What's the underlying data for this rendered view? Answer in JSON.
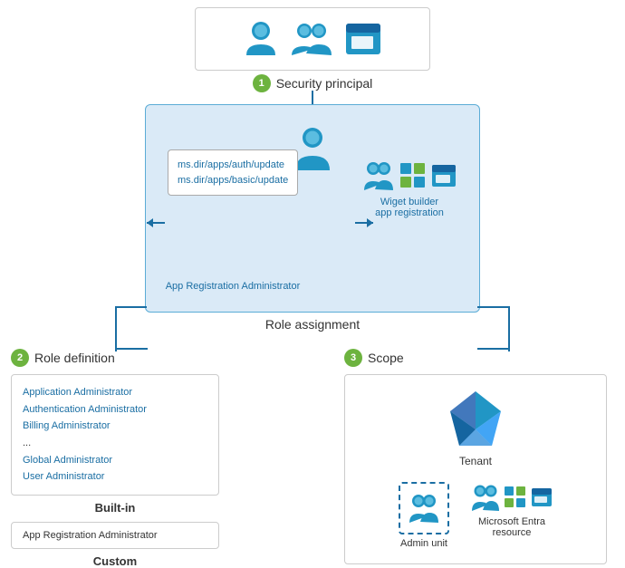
{
  "security_principal": {
    "label": "Security principal",
    "number": "1"
  },
  "role_assignment": {
    "label": "Role assignment",
    "app_reg_lines": [
      "ms.dir/apps/auth/update",
      "ms.dir/apps/basic/update"
    ],
    "app_reg_admin_label": "App Registration Administrator",
    "widget_builder_label": "Wiget builder\napp registration"
  },
  "role_definition": {
    "label": "Role definition",
    "number": "2",
    "built_in_roles": [
      "Application Administrator",
      "Authentication Administrator",
      "Billing Administrator",
      "...",
      "Global Administrator",
      "User Administrator"
    ],
    "built_in_label": "Built-in",
    "custom_role": "App Registration Administrator",
    "custom_label": "Custom"
  },
  "scope": {
    "label": "Scope",
    "number": "3",
    "tenant_label": "Tenant",
    "admin_unit_label": "Admin unit",
    "ms_entra_label": "Microsoft Entra\nresource"
  }
}
